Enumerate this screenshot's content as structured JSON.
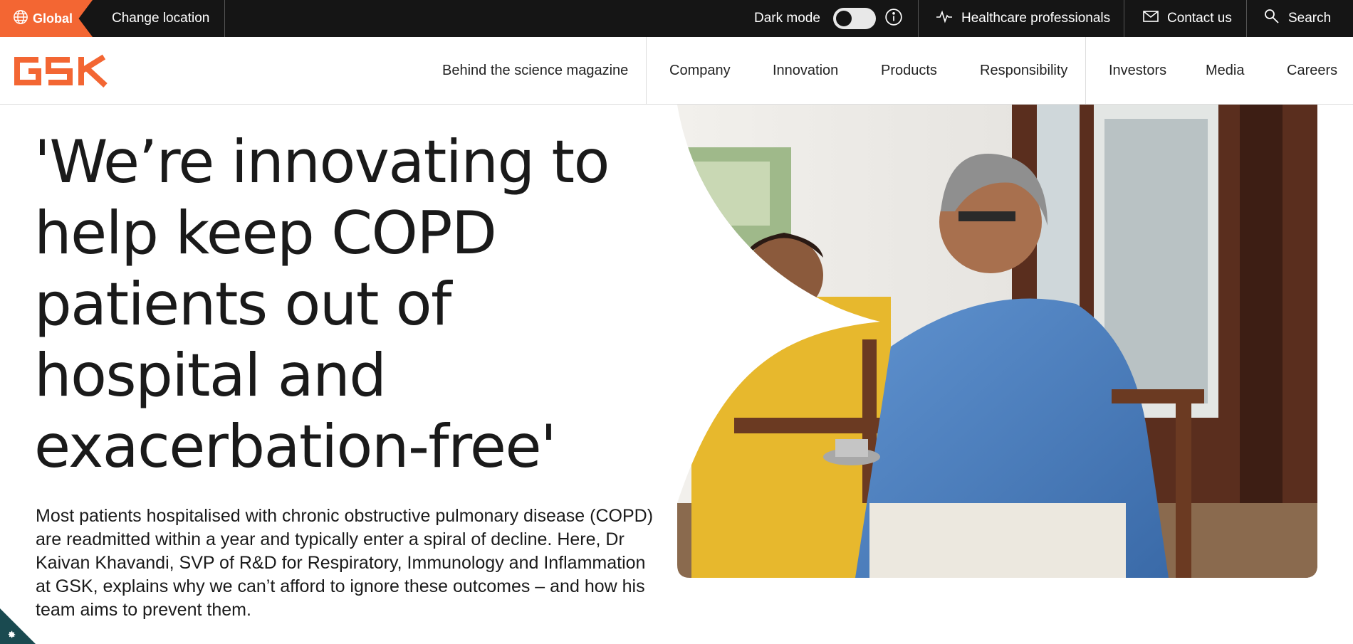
{
  "utility": {
    "global_label": "Global",
    "change_location": "Change location",
    "dark_mode_label": "Dark mode",
    "hcp_label": "Healthcare professionals",
    "contact_label": "Contact us",
    "search_label": "Search"
  },
  "brand": {
    "logo_text": "GSK",
    "accent": "#f36633",
    "bar_bg": "#151515"
  },
  "nav": {
    "items": [
      {
        "label": "Behind the science magazine"
      },
      {
        "label": "Company"
      },
      {
        "label": "Innovation"
      },
      {
        "label": "Products"
      },
      {
        "label": "Responsibility"
      },
      {
        "label": "Investors"
      },
      {
        "label": "Media"
      },
      {
        "label": "Careers"
      }
    ]
  },
  "hero": {
    "headline": "'We’re innovating to help keep COPD patients out of hospital and exacerbation-free'",
    "intro": "Most patients hospitalised with chronic obstructive pulmonary disease (COPD) are readmitted within a year and typically enter a spiral of decline. Here, Dr Kaivan Khavandi, SVP of R&D for Respiratory, Immunology and Inflammation at GSK, explains why we can’t afford to ignore these outcomes – and how his team aims to prevent them."
  },
  "icons": {
    "globe": "globe-icon",
    "info": "info-icon",
    "pulse": "pulse-icon",
    "mail": "mail-icon",
    "search": "search-icon",
    "cookie_settings": "gear-icon"
  }
}
